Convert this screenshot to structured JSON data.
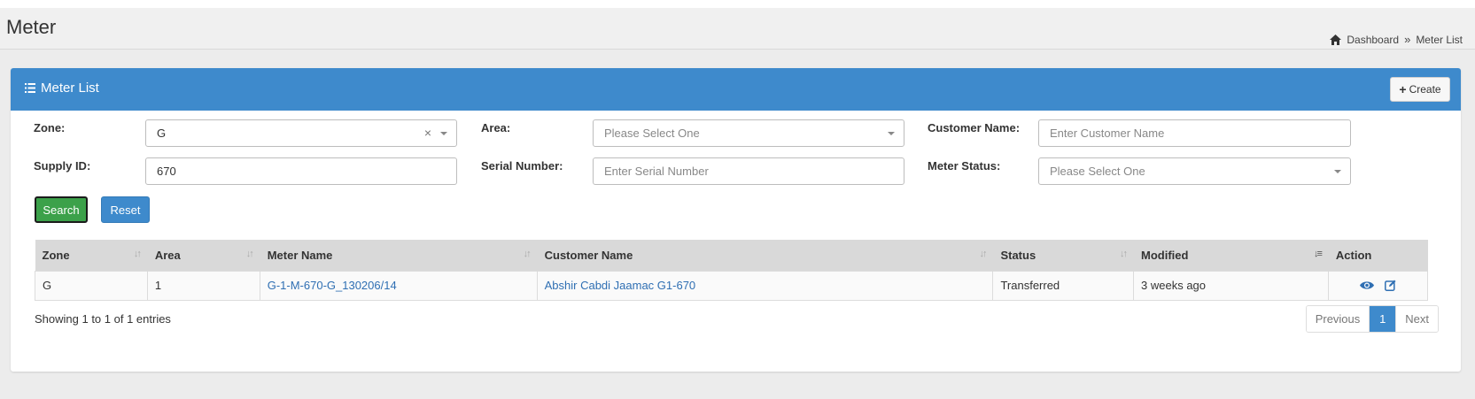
{
  "header": {
    "title": "Meter",
    "breadcrumb": {
      "home": "Dashboard",
      "separator": "»",
      "current": "Meter List"
    }
  },
  "box": {
    "title": "Meter List",
    "create_label": "Create"
  },
  "filters": {
    "zone": {
      "label": "Zone:",
      "value": "G",
      "clear": "×"
    },
    "area": {
      "label": "Area:",
      "placeholder": "Please Select One"
    },
    "customer_name": {
      "label": "Customer Name:",
      "placeholder": "Enter Customer Name"
    },
    "supply_id": {
      "label": "Supply ID:",
      "value": "670"
    },
    "serial_number": {
      "label": "Serial Number:",
      "placeholder": "Enter Serial Number"
    },
    "meter_status": {
      "label": "Meter Status:",
      "placeholder": "Please Select One"
    },
    "search_label": "Search",
    "reset_label": "Reset"
  },
  "table": {
    "columns": [
      "Zone",
      "Area",
      "Meter Name",
      "Customer Name",
      "Status",
      "Modified",
      "Action"
    ],
    "rows": [
      {
        "zone": "G",
        "area": "1",
        "meter_name": "G-1-M-670-G_130206/14",
        "customer_name": "Abshir Cabdi Jaamac G1-670",
        "status": "Transferred",
        "modified": "3 weeks ago"
      }
    ]
  },
  "footer": {
    "showing": "Showing 1 to 1 of 1 entries",
    "pager": {
      "previous": "Previous",
      "page": "1",
      "next": "Next"
    }
  },
  "colors": {
    "primary": "#3e8acc",
    "success": "#3ca14a",
    "link": "#2f6fb3"
  }
}
